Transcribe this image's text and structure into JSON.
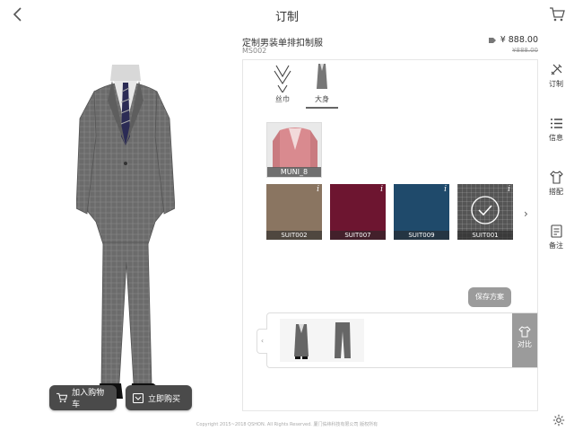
{
  "header": {
    "title": "订制"
  },
  "product": {
    "name": "定制男装单排扣制服",
    "code": "MS002",
    "price": "¥ 888.00",
    "original_price": "¥888.00"
  },
  "stage": {
    "add_to_cart": "加入购物车",
    "buy_now": "立即购买"
  },
  "categories": [
    {
      "label": "丝巾",
      "icon": "scarf-icon"
    },
    {
      "label": "大身",
      "icon": "suit-body-icon"
    }
  ],
  "selected_model": {
    "label": "MUNI_8"
  },
  "fabrics": [
    {
      "code": "SUIT002",
      "color": "#8a7561"
    },
    {
      "code": "SUIT007",
      "color": "#6d1530"
    },
    {
      "code": "SUIT009",
      "color": "#1f4a6b"
    },
    {
      "code": "SUIT001",
      "color": "#555555"
    }
  ],
  "actions": {
    "save_plan": "保存方案",
    "compare": "对比"
  },
  "rail": [
    {
      "label": "订制",
      "icon": "tools-icon"
    },
    {
      "label": "信息",
      "icon": "list-icon"
    },
    {
      "label": "搭配",
      "icon": "shirt-icon"
    },
    {
      "label": "备注",
      "icon": "note-icon"
    }
  ],
  "footer": {
    "copyright": "Copyright 2015~2018 QSHON. All Rights Reserved. 厦门佑纬科技有限公司 版权所有"
  }
}
